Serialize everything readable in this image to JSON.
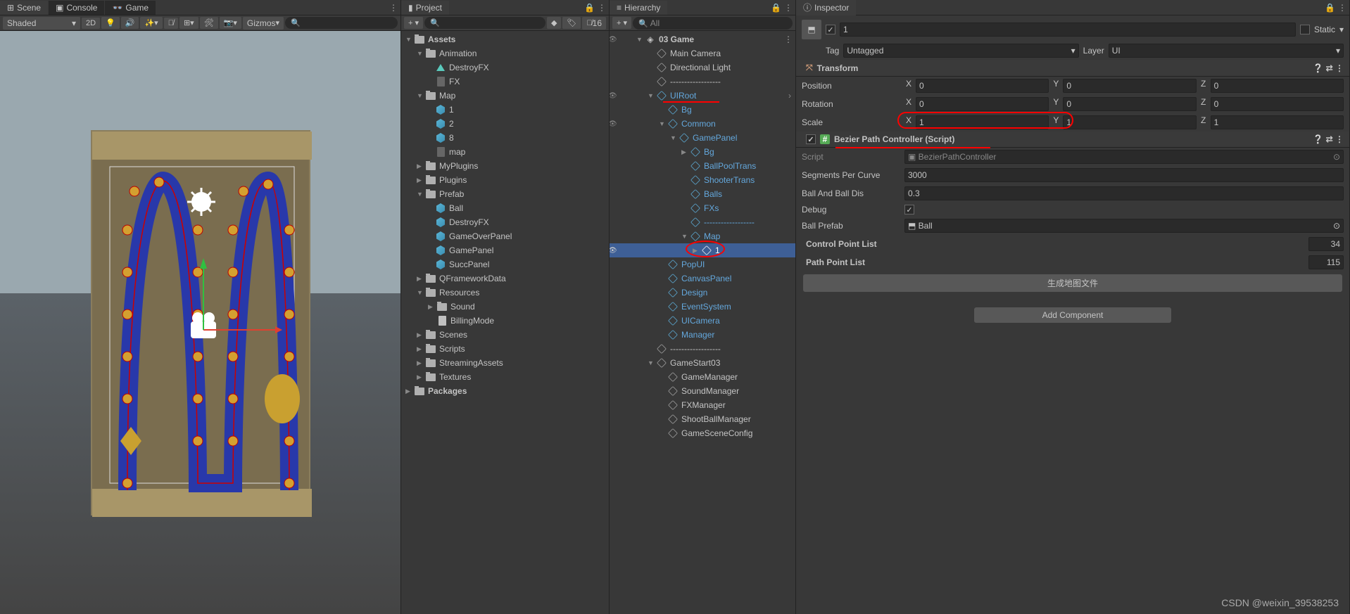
{
  "scene": {
    "tabs": {
      "scene": "Scene",
      "console": "Console",
      "game": "Game"
    },
    "toolbar": {
      "shaded": "Shaded",
      "btn2d": "2D",
      "gizmos": "Gizmos"
    }
  },
  "project": {
    "title": "Project",
    "search_placeholder": "",
    "hidden_count": "16",
    "tree": {
      "assets": "Assets",
      "animation": "Animation",
      "destroyfx": "DestroyFX",
      "fx": "FX",
      "map": "Map",
      "map1": "1",
      "map2": "2",
      "map8": "8",
      "mapm": "map",
      "myplugins": "MyPlugins",
      "plugins": "Plugins",
      "prefab": "Prefab",
      "pball": "Ball",
      "pdfx": "DestroyFX",
      "pgop": "GameOverPanel",
      "pgp": "GamePanel",
      "psp": "SuccPanel",
      "qf": "QFrameworkData",
      "resources": "Resources",
      "sound": "Sound",
      "billing": "BillingMode",
      "scenes": "Scenes",
      "scripts": "Scripts",
      "stream": "StreamingAssets",
      "textures": "Textures",
      "packages": "Packages"
    }
  },
  "hierarchy": {
    "title": "Hierarchy",
    "search": "All",
    "tree": {
      "game03": "03 Game",
      "camera": "Main Camera",
      "dirlight": "Directional Light",
      "sep1": "------------------",
      "uiroot": "UIRoot",
      "bg": "Bg",
      "common": "Common",
      "gamepanel": "GamePanel",
      "bg2": "Bg",
      "ballpool": "BallPoolTrans",
      "shooter": "ShooterTrans",
      "balls": "Balls",
      "fxs": "FXs",
      "sep2": "------------------",
      "maph": "Map",
      "one": "1",
      "popui": "PopUI",
      "canvas": "CanvasPanel",
      "design": "Design",
      "eventsys": "EventSystem",
      "uicam": "UICamera",
      "manager": "Manager",
      "sep3": "------------------",
      "gamestart": "GameStart03",
      "gmgr": "GameManager",
      "smgr": "SoundManager",
      "fxmgr": "FXManager",
      "sbmgr": "ShootBallManager",
      "gsc": "GameSceneConfig"
    }
  },
  "inspector": {
    "title": "Inspector",
    "static": "Static",
    "name": "1",
    "tag_label": "Tag",
    "tag_value": "Untagged",
    "layer_label": "Layer",
    "layer_value": "UI",
    "transform": {
      "title": "Transform",
      "position": "Position",
      "rotation": "Rotation",
      "scale": "Scale",
      "px": "0",
      "py": "0",
      "pz": "0",
      "rx": "0",
      "ry": "0",
      "rz": "0",
      "sx": "1",
      "sy": "1",
      "sz": "1"
    },
    "bezier": {
      "title": "Bezier Path Controller (Script)",
      "script_label": "Script",
      "script_value": "BezierPathController",
      "seg_label": "Segments Per Curve",
      "seg_value": "3000",
      "dist_label": "Ball And Ball Dis",
      "dist_value": "0.3",
      "debug_label": "Debug",
      "prefab_label": "Ball Prefab",
      "prefab_value": "Ball",
      "cpl_label": "Control Point List",
      "cpl_value": "34",
      "ppl_label": "Path Point List",
      "ppl_value": "115",
      "gen_btn": "生成地图文件",
      "add_comp": "Add Component"
    }
  },
  "watermark": "CSDN @weixin_39538253"
}
